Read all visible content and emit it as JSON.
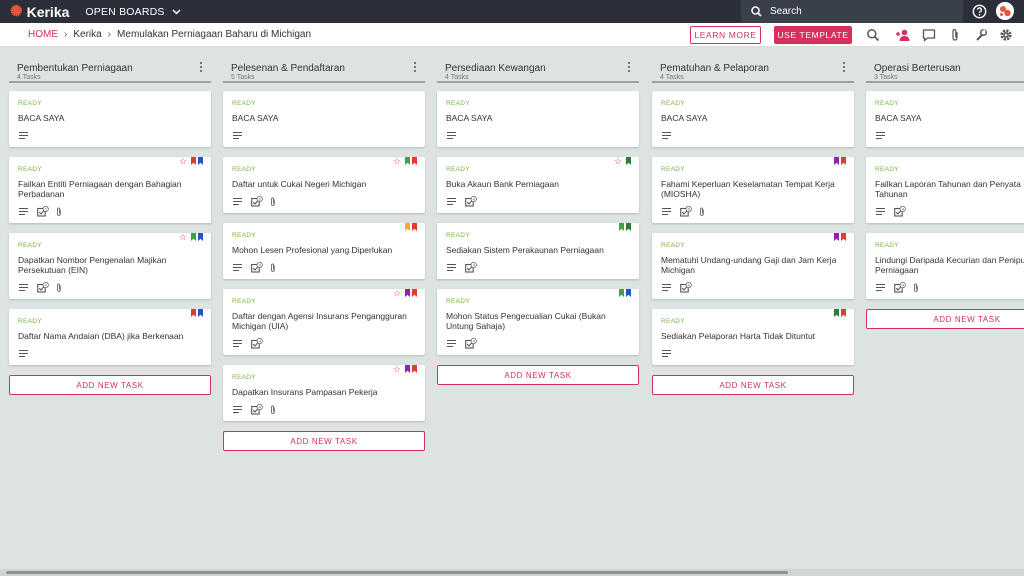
{
  "app": {
    "name": "Kerika",
    "boards_menu": "OPEN BOARDS"
  },
  "search": {
    "placeholder": "Search"
  },
  "breadcrumb": {
    "home": "HOME",
    "items": [
      "Kerika",
      "Memulakan Perniagaan Baharu di Michigan"
    ]
  },
  "toolbar": {
    "learn_more": "LEARN MORE",
    "use_template": "USE TEMPLATE"
  },
  "icons": [
    "search-icon",
    "add-person-icon",
    "chat-icon",
    "attachment-icon",
    "wrench-icon",
    "gear-icon",
    "help-icon"
  ],
  "colors": {
    "accent": "#d62f5b",
    "status_ready": "#7cb342",
    "topbar": "#2b2f3a",
    "board_bg": "#dde3e0"
  },
  "add_task_label": "ADD NEW TASK",
  "columns": [
    {
      "title": "Pembentukan Perniagaan",
      "count": "4 Tasks",
      "cards": [
        {
          "status": "READY",
          "title": "BACA SAYA",
          "tasks": null,
          "attach": false,
          "star": false,
          "flags": []
        },
        {
          "status": "READY",
          "title": "Failkan Entiti Perniagaan dengan Bahagian Perbadanan",
          "tasks": "2",
          "attach": true,
          "star": true,
          "flags": [
            "#e53935",
            "#1e56c8"
          ]
        },
        {
          "status": "READY",
          "title": "Dapatkan Nombor Pengenalan Majikan Persekutuan (EIN)",
          "tasks": "4",
          "attach": true,
          "star": true,
          "flags": [
            "#43a047",
            "#1e56c8"
          ]
        },
        {
          "status": "READY",
          "title": "Daftar Nama Andaian (DBA) jika Berkenaan",
          "tasks": null,
          "attach": false,
          "star": false,
          "flags": [
            "#e53935",
            "#1e56c8"
          ]
        }
      ]
    },
    {
      "title": "Pelesenan & Pendaftaran",
      "count": "5 Tasks",
      "cards": [
        {
          "status": "READY",
          "title": "BACA SAYA",
          "tasks": null,
          "attach": false,
          "star": false,
          "flags": []
        },
        {
          "status": "READY",
          "title": "Daftar untuk Cukai Negeri Michigan",
          "tasks": "5",
          "attach": true,
          "star": true,
          "flags": [
            "#43a047",
            "#e53935"
          ]
        },
        {
          "status": "READY",
          "title": "Mohon Lesen Profesional yang Diperlukan",
          "tasks": "4",
          "attach": true,
          "star": false,
          "flags": [
            "#f9a825",
            "#e53935"
          ]
        },
        {
          "status": "READY",
          "title": "Daftar dengan Agensi Insurans Pengangguran Michigan (UIA)",
          "tasks": "4",
          "attach": false,
          "star": true,
          "flags": [
            "#8e24aa",
            "#e53935"
          ]
        },
        {
          "status": "READY",
          "title": "Dapatkan Insurans Pampasan Pekerja",
          "tasks": "4",
          "attach": true,
          "star": true,
          "flags": [
            "#8e24aa",
            "#e53935"
          ]
        }
      ]
    },
    {
      "title": "Persediaan Kewangan",
      "count": "4 Tasks",
      "cards": [
        {
          "status": "READY",
          "title": "BACA SAYA",
          "tasks": null,
          "attach": false,
          "star": false,
          "flags": []
        },
        {
          "status": "READY",
          "title": "Buka Akaun Bank Perniagaan",
          "tasks": "4",
          "attach": false,
          "star": true,
          "flags": [
            "#2e7d32"
          ]
        },
        {
          "status": "READY",
          "title": "Sediakan Sistem Perakaunan Perniagaan",
          "tasks": "4",
          "attach": false,
          "star": false,
          "flags": [
            "#43a047",
            "#2e7d32"
          ]
        },
        {
          "status": "READY",
          "title": "Mohon Status Pengecualian Cukai (Bukan Untung Sahaja)",
          "tasks": "4",
          "attach": false,
          "star": false,
          "flags": [
            "#43a047",
            "#1e56c8"
          ]
        }
      ]
    },
    {
      "title": "Pematuhan & Pelaporan",
      "count": "4 Tasks",
      "cards": [
        {
          "status": "READY",
          "title": "BACA SAYA",
          "tasks": null,
          "attach": false,
          "star": false,
          "flags": []
        },
        {
          "status": "READY",
          "title": "Fahami Keperluan Keselamatan Tempat Kerja (MIOSHA)",
          "tasks": "4",
          "attach": true,
          "star": false,
          "flags": [
            "#8e24aa",
            "#e53935"
          ]
        },
        {
          "status": "READY",
          "title": "Mematuhi Undang-undang Gaji dan Jam Kerja Michigan",
          "tasks": "4",
          "attach": false,
          "star": false,
          "flags": [
            "#8e24aa",
            "#e53935"
          ]
        },
        {
          "status": "READY",
          "title": "Sediakan Pelaporan Harta Tidak Dituntut",
          "tasks": null,
          "attach": false,
          "star": false,
          "flags": [
            "#2e7d32",
            "#e53935"
          ]
        }
      ]
    },
    {
      "title": "Operasi Berterusan",
      "count": "3 Tasks",
      "cards": [
        {
          "status": "READY",
          "title": "BACA SAYA",
          "tasks": null,
          "attach": false,
          "star": false,
          "flags": []
        },
        {
          "status": "READY",
          "title": "Failkan Laporan Tahunan dan Penyata Tahunan",
          "tasks": "4",
          "attach": false,
          "star": false,
          "flags": []
        },
        {
          "status": "READY",
          "title": "Lindungi Daripada Kecurian dan Penipuan Perniagaan",
          "tasks": "4",
          "attach": true,
          "star": false,
          "flags": []
        }
      ]
    }
  ]
}
